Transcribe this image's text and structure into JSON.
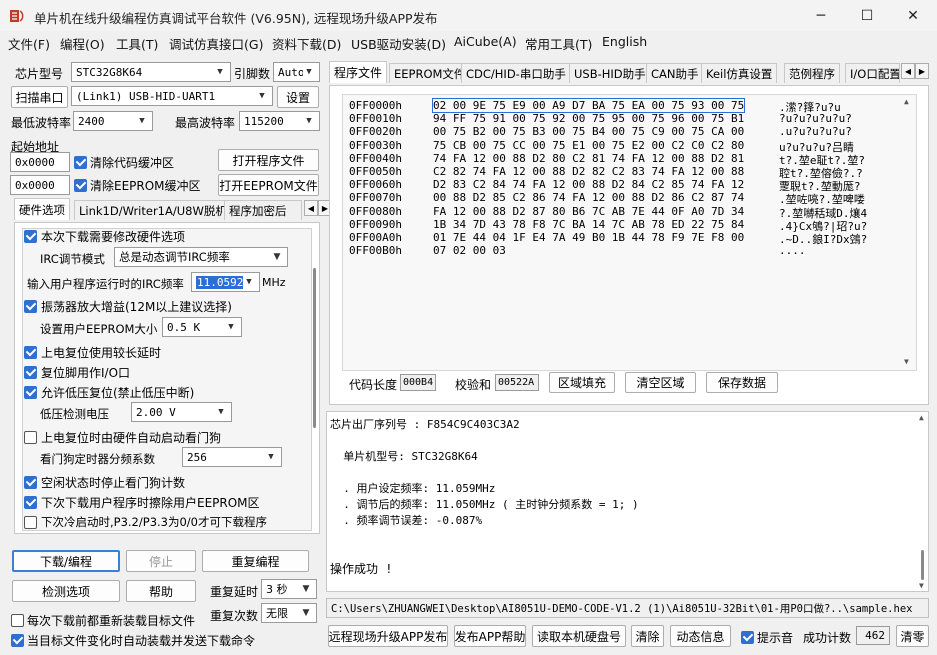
{
  "window": {
    "title": "单片机在线升级编程仿真调试平台软件 (V6.95N), 远程现场升级APP发布",
    "minimize": "─",
    "maximize": "☐",
    "close": "✕"
  },
  "menu": [
    "文件(F)",
    "编程(O)",
    "工具(T)",
    "调试仿真接口(G)",
    "资料下载(D)",
    "USB驱动安装(D)",
    "AiCube(A)",
    "常用工具(T)",
    "English"
  ],
  "left": {
    "chip_model_label": "芯片型号",
    "chip_model_value": "STC32G8K64",
    "pin_count_label": "引脚数",
    "pin_count_value": "Auto",
    "scan_port_button": "扫描串口",
    "port_value": "(Link1) USB-HID-UART1",
    "settings_button": "设置",
    "min_baud_label": "最低波特率",
    "min_baud_value": "2400",
    "max_baud_label": "最高波特率",
    "max_baud_value": "115200",
    "start_addr_label": "起始地址",
    "code_addr_value": "0x0000",
    "clear_code_label": "清除代码缓冲区",
    "open_program_button": "打开程序文件",
    "eeprom_addr_value": "0x0000",
    "clear_eeprom_label": "清除EEPROM缓冲区",
    "open_eeprom_button": "打开EEPROM文件"
  },
  "hw_tabs": [
    "硬件选项",
    "Link1D/Writer1A/U8W脱机",
    "程序加密后"
  ],
  "hw_options": {
    "modify_hw_label": "本次下载需要修改硬件选项",
    "irc_mode_label": "IRC调节模式",
    "irc_mode_value": "总是动态调节IRC频率",
    "irc_freq_label": "输入用户程序运行时的IRC频率",
    "irc_freq_value": "11.0592",
    "irc_freq_unit": "MHz",
    "osc_gain_label": "振荡器放大增益(12M以上建议选择)",
    "eeprom_size_label": "设置用户EEPROM大小",
    "eeprom_size_value": "0.5 K",
    "power_on_delay_label": "上电复位使用较长延时",
    "reset_pin_io_label": "复位脚用作I/O口",
    "low_volt_reset_label": "允许低压复位(禁止低压中断)",
    "low_volt_detect_label": "低压检测电压",
    "low_volt_detect_value": "2.00 V",
    "wdt_auto_label": "上电复位时由硬件自动启动看门狗",
    "wdt_prescale_label": "看门狗定时器分频系数",
    "wdt_prescale_value": "256",
    "idle_stop_wdt_label": "空闲状态时停止看门狗计数",
    "erase_eeprom_label": "下次下载用户程序时擦除用户EEPROM区",
    "cold_boot_label": "下次冷启动时,P3.2/P3.3为0/0才可下载程序"
  },
  "actions": {
    "download_button": "下载/编程",
    "stop_button": "停止",
    "reprogram_button": "重复编程",
    "detect_options_button": "检测选项",
    "help_button": "帮助",
    "repeat_delay_label": "重复延时",
    "repeat_delay_value": "3 秒",
    "reload_label": "每次下载前都重新装载目标文件",
    "repeat_count_label": "重复次数",
    "repeat_count_value": "无限",
    "auto_send_label": "当目标文件变化时自动装载并发送下载命令"
  },
  "main_tabs": [
    "程序文件",
    "EEPROM文件",
    "CDC/HID-串口助手",
    "USB-HID助手",
    "CAN助手",
    "Keil仿真设置",
    "范例程序",
    "I/O口配置"
  ],
  "hex": {
    "rows": [
      {
        "addr": "0FF0000h",
        "bytes": "02 00 9E 75 E9 00 A9 D7 BA 75 EA 00 75 93 00 75",
        "ascii": ".潆?箨?u?u"
      },
      {
        "addr": "0FF0010h",
        "bytes": "94 FF 75 91 00 75 92 00 75 95 00 75 96 00 75 B1",
        "ascii": "?u?u?u?u?u?"
      },
      {
        "addr": "0FF0020h",
        "bytes": "00 75 B2 00 75 B3 00 75 B4 00 75 C9 00 75 CA 00",
        "ascii": ".u?u?u?u?u?"
      },
      {
        "addr": "0FF0030h",
        "bytes": "75 CB 00 75 CC 00 75 E1 00 75 E2 00 C2 C0 C2 80",
        "ascii": "u?u?u?u?吕睛"
      },
      {
        "addr": "0FF0040h",
        "bytes": "74 FA 12 00 88 D2 80 C2 81 74 FA 12 00 88 D2 81",
        "ascii": "t?.堃e聇t?.堃?"
      },
      {
        "addr": "0FF0050h",
        "bytes": "C2 82 74 FA 12 00 88 D2 82 C2 83 74 FA 12 00 88",
        "ascii": "聜t?.堃傛儉?.?"
      },
      {
        "addr": "0FF0060h",
        "bytes": "D2 83 C2 84 74 FA 12 00 88 D2 84 C2 85 74 FA 12",
        "ascii": "覂聣t?.堃動厖?"
      },
      {
        "addr": "0FF0070h",
        "bytes": "00 88 D2 85 C2 86 74 FA 12 00 88 D2 86 C2 87 74",
        "ascii": ".堃咗喨?.堃啤喽"
      },
      {
        "addr": "0FF0080h",
        "bytes": "FA 12 00 88 D2 87 80 B6 7C AB 7E 44 0F A0 7D 34",
        "ascii": "?.堃嚩秳琙D.爙4"
      },
      {
        "addr": "0FF0090h",
        "bytes": "1B 34 7D 43 78 F8 7C BA 14 7C AB 78 ED 22 75 84",
        "ascii": ".4}Cx鴝?|玿?u?"
      },
      {
        "addr": "0FF00A0h",
        "bytes": "01 7E 44 04 1F E4 7A 49 B0 1B 44 78 F9 7E F8 00",
        "ascii": ".~D..鋃I?Dx鵼?"
      },
      {
        "addr": "0FF00B0h",
        "bytes": "07 02 00 03",
        "ascii": "...."
      }
    ],
    "code_len_label": "代码长度",
    "code_len_value": "000B4",
    "checksum_label": "校验和",
    "checksum_value": "00522A",
    "fill_button": "区域填充",
    "clear_button": "清空区域",
    "save_button": "保存数据"
  },
  "log": {
    "lines": [
      "芯片出厂序列号 : F854C9C403C3A2",
      "",
      "  单片机型号: STC32G8K64",
      "",
      "  . 用户设定频率: 11.059MHz",
      "  . 调节后的频率: 11.050MHz ( 主时钟分频系数 = 1; )",
      "  . 频率调节误差: -0.087%",
      "",
      "",
      "操作成功 !"
    ]
  },
  "path_value": "C:\\Users\\ZHUANGWEI\\Desktop\\AI8051U-DEMO-CODE-V1.2 (1)\\Ai8051U-32Bit\\01-用P0口做?..\\sample.hex",
  "bottom": {
    "publish_button": "远程现场升级APP发布",
    "publish_help_button": "发布APP帮助",
    "read_disk_button": "读取本机硬盘号",
    "clear_button": "清除",
    "dynamic_info_button": "动态信息",
    "beep_label": "提示音",
    "success_count_label": "成功计数",
    "success_count_value": "462",
    "reset_count_button": "清零"
  }
}
